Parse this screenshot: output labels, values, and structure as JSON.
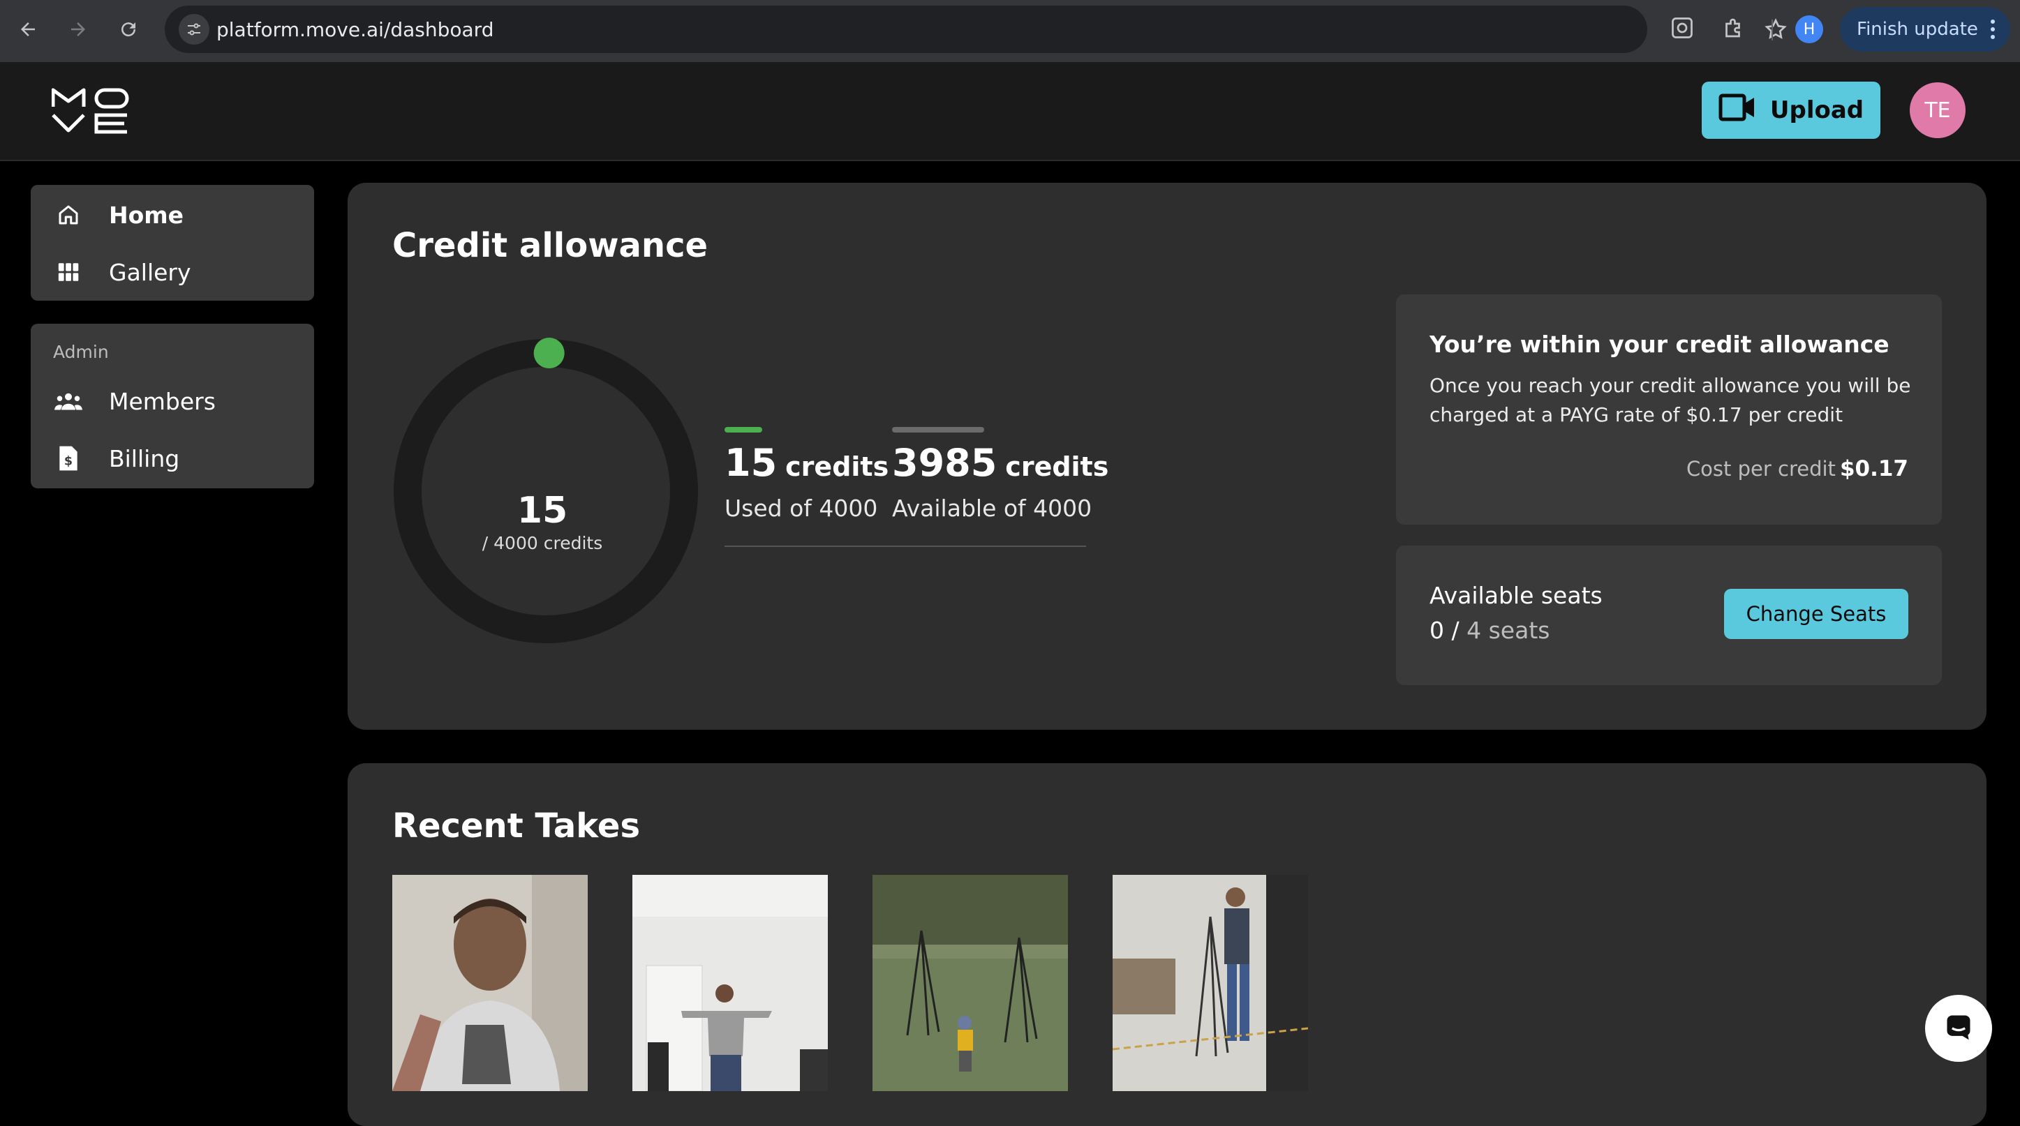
{
  "browser": {
    "url": "platform.move.ai/dashboard",
    "profile_initial": "H",
    "finish_update_label": "Finish update"
  },
  "header": {
    "upload_label": "Upload",
    "avatar_initials": "TE"
  },
  "sidebar": {
    "items": [
      {
        "label": "Home",
        "icon": "home-icon"
      },
      {
        "label": "Gallery",
        "icon": "grid-icon"
      }
    ],
    "admin_label": "Admin",
    "admin_items": [
      {
        "label": "Members",
        "icon": "users-icon"
      },
      {
        "label": "Billing",
        "icon": "invoice-icon"
      }
    ]
  },
  "credits": {
    "title": "Credit allowance",
    "used": "15",
    "total_label": "/ 4000 credits",
    "used_fraction": 0.00375,
    "used_value": "15",
    "used_unit": "credits",
    "used_caption": "Used of 4000",
    "available_value": "3985",
    "available_unit": "credits",
    "available_caption": "Available of 4000",
    "used_color": "#4caf50",
    "available_color": "#6b6b6b"
  },
  "allowance_card": {
    "title": "You’re within your credit allowance",
    "text": "Once you reach your credit allowance you will be charged at a PAYG rate of $0.17 per credit",
    "cost_label": "Cost per credit",
    "cost_value": "$0.17"
  },
  "seats_card": {
    "label": "Available seats",
    "used": "0",
    "separator": "/",
    "total": "4 seats",
    "button_label": "Change Seats"
  },
  "recent": {
    "title": "Recent Takes",
    "thumbnails": [
      "take-1",
      "take-2",
      "take-3",
      "take-4"
    ]
  },
  "colors": {
    "accent": "#5ac8dd",
    "avatar": "#e07aa8",
    "panel": "#2e2e2e",
    "card": "#3a3a3a"
  }
}
